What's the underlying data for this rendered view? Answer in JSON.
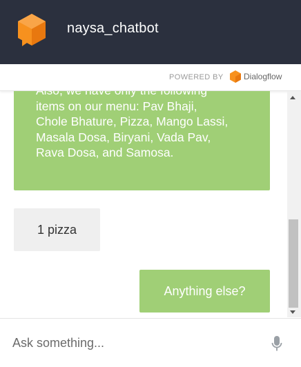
{
  "header": {
    "title": "naysa_chatbot"
  },
  "powered": {
    "label": "POWERED BY",
    "brand": "Dialogflow"
  },
  "messages": {
    "bot1_lines": [
      "Also, we have only the following",
      "items on our menu: Pav Bhaji,",
      "Chole Bhature, Pizza, Mango Lassi,",
      "Masala Dosa, Biryani, Vada Pav,",
      "Rava Dosa, and Samosa."
    ],
    "user1": "1 pizza",
    "bot2": "Anything else?"
  },
  "input": {
    "placeholder": "Ask something..."
  },
  "colors": {
    "header_bg": "#2b303e",
    "accent": "#f7911e",
    "bot_bubble": "#a0cf76",
    "user_bubble": "#efefef"
  },
  "icons": {
    "logo": "dialogflow-cube-icon",
    "mic": "microphone-icon"
  }
}
